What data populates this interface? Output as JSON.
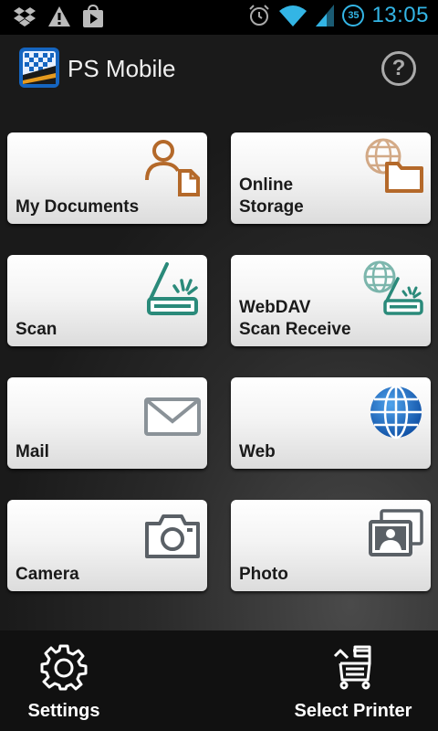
{
  "status_bar": {
    "time": "13:05",
    "badge": "35",
    "left_icons": [
      "dropbox-icon",
      "warning-icon",
      "play-store-icon"
    ],
    "right_icons": [
      "alarm-icon",
      "wifi-icon",
      "signal-icon"
    ]
  },
  "app": {
    "title": "PS Mobile",
    "help_symbol": "?"
  },
  "tiles": [
    {
      "line1": "My Documents",
      "line2": "",
      "icon": "documents-icon",
      "accent": "#b4692a"
    },
    {
      "line1": "Online",
      "line2": "Storage",
      "icon": "online-storage-icon",
      "accent": "#b4692a"
    },
    {
      "line1": "Scan",
      "line2": "",
      "icon": "scanner-icon",
      "accent": "#2a8a7a"
    },
    {
      "line1": "WebDAV",
      "line2": "Scan Receive",
      "icon": "webdav-scan-icon",
      "accent": "#2a8a7a"
    },
    {
      "line1": "Mail",
      "line2": "",
      "icon": "mail-icon",
      "accent": "#8a9298"
    },
    {
      "line1": "Web",
      "line2": "",
      "icon": "globe-icon",
      "accent": "#1f6fbf"
    },
    {
      "line1": "Camera",
      "line2": "",
      "icon": "camera-icon",
      "accent": "#5a6066"
    },
    {
      "line1": "Photo",
      "line2": "",
      "icon": "photo-icon",
      "accent": "#5a6066"
    }
  ],
  "bottom_bar": {
    "settings_label": "Settings",
    "select_printer_label": "Select Printer"
  }
}
